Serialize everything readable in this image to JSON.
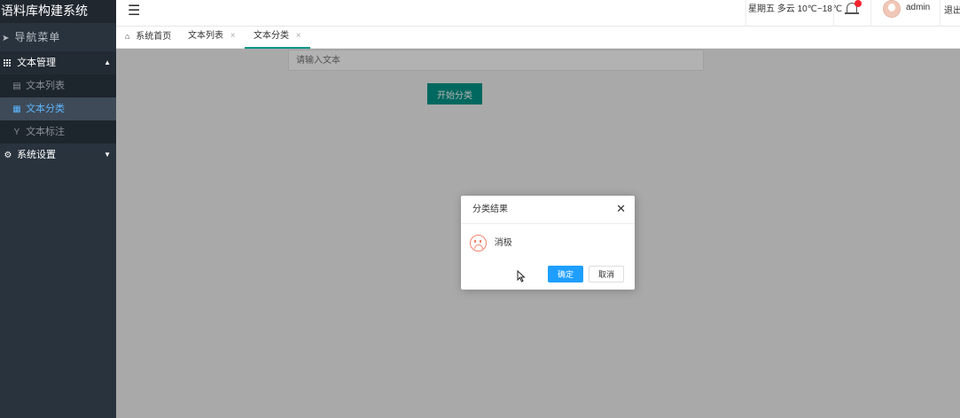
{
  "app": {
    "title": "语料库构建系统"
  },
  "sidebar": {
    "nav_title": "导航菜单",
    "groups": [
      {
        "label": "文本管理",
        "items": [
          {
            "label": "文本列表"
          },
          {
            "label": "文本分类"
          },
          {
            "label": "文本标注"
          }
        ]
      },
      {
        "label": "系统设置"
      }
    ]
  },
  "header": {
    "weather": "星期五 多云 10℃~18℃",
    "user": "admin",
    "logout": "退出"
  },
  "tabs": [
    {
      "label": "系统首页"
    },
    {
      "label": "文本列表"
    },
    {
      "label": "文本分类"
    }
  ],
  "main": {
    "text_input": {
      "placeholder": "请输入文本",
      "value": ""
    },
    "start_button": "开始分类"
  },
  "dialog": {
    "title": "分类结果",
    "message": "消极",
    "ok": "确定",
    "cancel": "取消"
  },
  "colors": {
    "sidebar_bg": "#28333e",
    "primary": "#009688",
    "active_link": "#5bb6ff",
    "confirm": "#1e9fff",
    "sad_icon": "#f0836b",
    "badge": "#f5222d"
  }
}
